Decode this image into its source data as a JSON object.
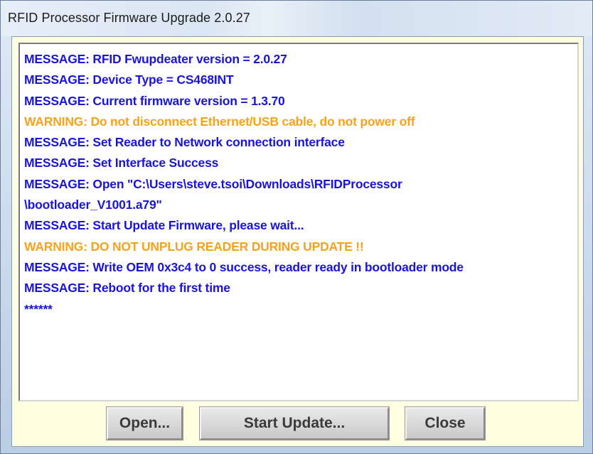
{
  "window": {
    "title": "RFID Processor Firmware Upgrade 2.0.27"
  },
  "log": {
    "lines": [
      {
        "type": "message",
        "text": "MESSAGE: RFID Fwupdeater version = 2.0.27"
      },
      {
        "type": "message",
        "text": "MESSAGE: Device Type = CS468INT"
      },
      {
        "type": "message",
        "text": "MESSAGE: Current firmware version = 1.3.70"
      },
      {
        "type": "warning",
        "text": "WARNING: Do not disconnect Ethernet/USB cable, do not power off"
      },
      {
        "type": "message",
        "text": "MESSAGE: Set Reader to Network connection interface"
      },
      {
        "type": "message",
        "text": "MESSAGE: Set Interface Success"
      },
      {
        "type": "message",
        "text": "MESSAGE: Open \"C:\\Users\\steve.tsoi\\Downloads\\RFIDProcessor"
      },
      {
        "type": "message",
        "text": "\\bootloader_V1001.a79\""
      },
      {
        "type": "message",
        "text": "MESSAGE: Start Update Firmware, please wait..."
      },
      {
        "type": "warning",
        "text": "WARNING: DO NOT UNPLUG READER DURING UPDATE !!"
      },
      {
        "type": "message",
        "text": "MESSAGE: Write OEM 0x3c4 to 0 success, reader ready in bootloader mode"
      },
      {
        "type": "message",
        "text": "MESSAGE: Reboot for the first time"
      },
      {
        "type": "message",
        "text": "******"
      }
    ]
  },
  "buttons": {
    "open_label": "Open...",
    "start_update_label": "Start Update...",
    "close_label": "Close"
  },
  "colors": {
    "message": "#1a14d6",
    "warning": "#f7a21b",
    "panel_background": "#ffffe1"
  }
}
